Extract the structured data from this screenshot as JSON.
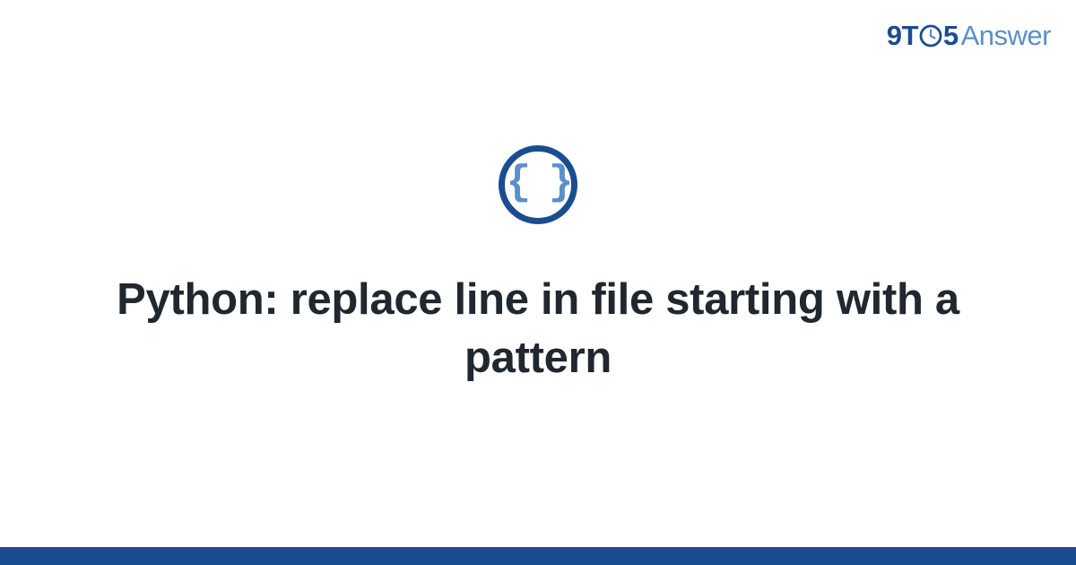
{
  "logo": {
    "part1": "9",
    "part2": "T",
    "part3": "5",
    "part4": "Answer"
  },
  "topic": {
    "icon_name": "braces-icon",
    "icon_content": "{ }"
  },
  "question": {
    "title": "Python: replace line in file starting with a pattern"
  },
  "colors": {
    "brand_dark": "#1a4d8f",
    "brand_light": "#5b8fc9",
    "text_dark": "#21272f"
  }
}
